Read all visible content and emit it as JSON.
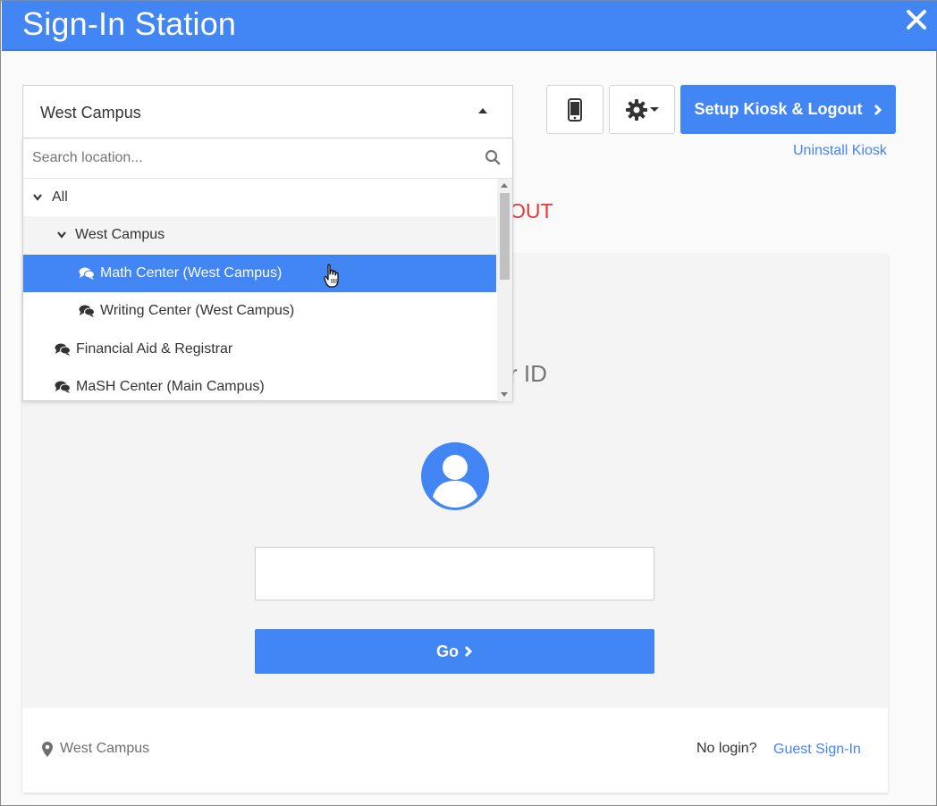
{
  "window": {
    "title": "Sign-In Station"
  },
  "location_select": {
    "value": "West Campus",
    "search_placeholder": "Search location...",
    "tree": [
      {
        "label": "All",
        "type": "group",
        "expanded": true
      },
      {
        "label": "West Campus",
        "type": "group",
        "expanded": true
      },
      {
        "label": "Math Center (West Campus)",
        "type": "location",
        "selected": true
      },
      {
        "label": "Writing Center (West Campus)",
        "type": "location"
      },
      {
        "label": "Financial Aid & Registrar",
        "type": "location"
      },
      {
        "label": "MaSH Center (Main Campus)",
        "type": "location"
      }
    ]
  },
  "toolbar": {
    "mobile_icon": "mobile-phone-icon",
    "settings_icon": "gear-icon",
    "setup_label": "Setup Kiosk & Logout",
    "uninstall_label": "Uninstall Kiosk"
  },
  "main": {
    "red_text_fragment": "OUT",
    "prompt_fragment": "r ID",
    "id_input_value": "",
    "go_label": "Go"
  },
  "footer": {
    "location_label": "West Campus",
    "no_login_label": "No login?",
    "guest_label": "Guest Sign-In"
  },
  "colors": {
    "primary": "#4285f4",
    "danger": "#e53935",
    "selected_row": "#4285f4"
  }
}
